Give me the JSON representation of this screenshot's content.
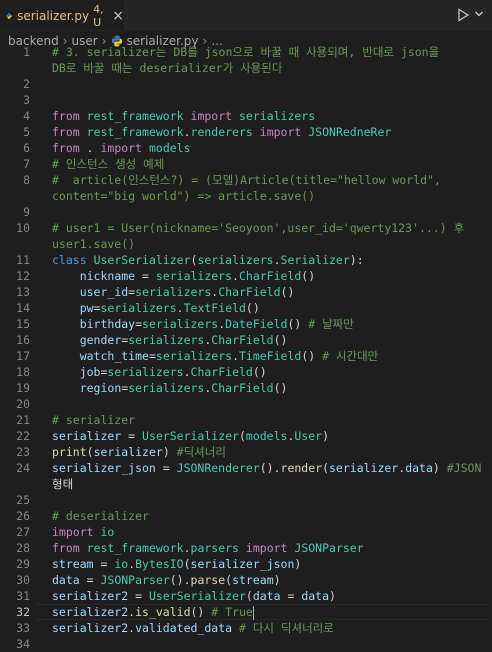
{
  "tab": {
    "filename": "serializer.py",
    "status": "4, U",
    "close_glyph": "×"
  },
  "toolbar": {
    "run_icon": "play-icon",
    "dropdown_icon": "chevron-down-icon"
  },
  "breadcrumb": {
    "items": [
      "backend",
      "user",
      "serializer.py",
      "..."
    ],
    "separator": "›"
  },
  "colors": {
    "background": "#1e1e1e",
    "comment": "#6a9955",
    "keyword": "#c586c0",
    "class": "#4ec9b0",
    "variable": "#9cdcfe",
    "function": "#dcdcaa",
    "string": "#ce9178",
    "modified_tab": "#e2c08d"
  },
  "editor": {
    "current_line": 32,
    "lines": [
      {
        "n": "1",
        "text": "# 3. serializer는 DB를 json으로 바꿀 때 사용되며, 반대로 json을"
      },
      {
        "n": "",
        "text": "DB로 바꿀 때는 deserializer가 사용된다"
      },
      {
        "n": "2",
        "text": ""
      },
      {
        "n": "3",
        "text": ""
      },
      {
        "n": "4",
        "text": "from rest_framework import serializers"
      },
      {
        "n": "5",
        "text": "from rest_framework.renderers import JSONRedneRer"
      },
      {
        "n": "6",
        "text": "from . import models"
      },
      {
        "n": "7",
        "text": "# 인스턴스 생성 예제"
      },
      {
        "n": "8",
        "text": "#  article(인스턴스?) = (모델)Article(title=\"hellow world\","
      },
      {
        "n": "",
        "text": "content=\"big world\") => article.save()"
      },
      {
        "n": "9",
        "text": ""
      },
      {
        "n": "10",
        "text": "# user1 = User(nickname='Seoyoon',user_id='qwerty123'...) 후"
      },
      {
        "n": "",
        "text": "user1.save()"
      },
      {
        "n": "11",
        "text": "class UserSerializer(serializers.Serializer):"
      },
      {
        "n": "12",
        "text": "    nickname = serializers.CharField()"
      },
      {
        "n": "13",
        "text": "    user_id=serializers.CharField()"
      },
      {
        "n": "14",
        "text": "    pw=serializers.TextField()"
      },
      {
        "n": "15",
        "text": "    birthday=serializers.DateField() # 날짜만"
      },
      {
        "n": "16",
        "text": "    gender=serializers.CharField()"
      },
      {
        "n": "17",
        "text": "    watch_time=serializers.TimeField() # 시간대만"
      },
      {
        "n": "18",
        "text": "    job=serializers.CharField()"
      },
      {
        "n": "19",
        "text": "    region=serializers.CharField()"
      },
      {
        "n": "20",
        "text": ""
      },
      {
        "n": "21",
        "text": "# serializer"
      },
      {
        "n": "22",
        "text": "serializer = UserSerializer(models.User)"
      },
      {
        "n": "23",
        "text": "print(serializer) #딕셔너리"
      },
      {
        "n": "24",
        "text": "serializer_json = JSONRenderer().render(serializer.data) #JSON"
      },
      {
        "n": "",
        "text": "형태"
      },
      {
        "n": "25",
        "text": ""
      },
      {
        "n": "26",
        "text": "# deserializer"
      },
      {
        "n": "27",
        "text": "import io"
      },
      {
        "n": "28",
        "text": "from rest_framework.parsers import JSONParser"
      },
      {
        "n": "29",
        "text": "stream = io.BytesIO(serializer_json)"
      },
      {
        "n": "30",
        "text": "data = JSONParser().parse(stream)"
      },
      {
        "n": "31",
        "text": "serializer2 = UserSerializer(data = data)"
      },
      {
        "n": "32",
        "text": "serializer2.is_valid() # True"
      },
      {
        "n": "33",
        "text": "serializer2.validated_data # 다시 딕셔너리로 "
      },
      {
        "n": "34",
        "text": ""
      }
    ]
  }
}
